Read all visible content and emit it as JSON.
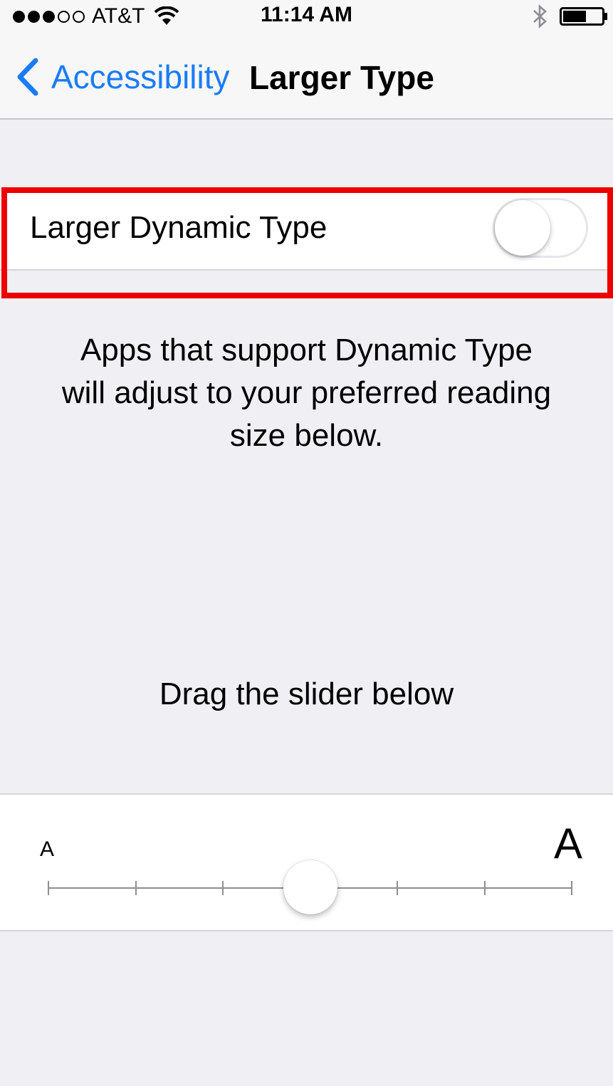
{
  "status_bar": {
    "carrier": "AT&T",
    "signal_bars_filled": 3,
    "signal_bars_total": 5,
    "time": "11:14 AM",
    "icons": [
      "wifi-icon",
      "bluetooth-icon",
      "battery-icon"
    ],
    "battery_level": 0.6
  },
  "nav": {
    "back_label": "Accessibility",
    "title": "Larger Type",
    "accent_color": "#1a7cf5"
  },
  "toggle": {
    "label": "Larger Dynamic Type",
    "on": false
  },
  "description": "Apps that support Dynamic Type will adjust to your preferred reading size below.",
  "hint": "Drag the slider below",
  "slider": {
    "min_label": "A",
    "max_label": "A",
    "steps": 7,
    "selected_step": 4
  },
  "highlight_color": "#ee0000"
}
